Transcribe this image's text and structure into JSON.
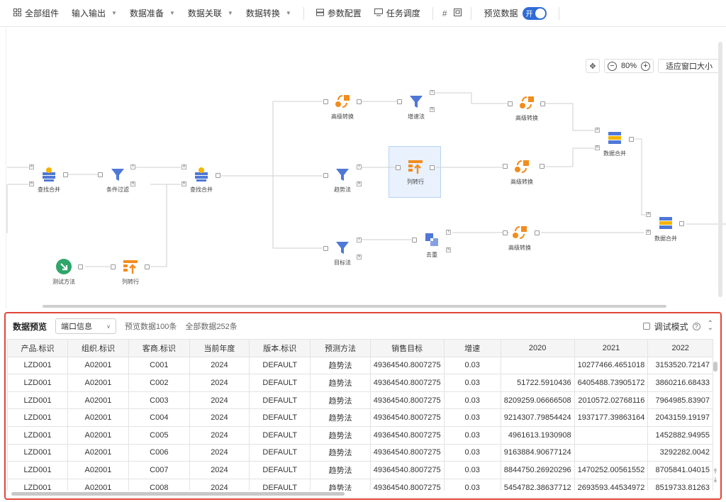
{
  "toolbar": {
    "all_components": "全部组件",
    "io": "输入输出",
    "data_prep": "数据准备",
    "data_join": "数据关联",
    "data_transform": "数据转换",
    "param_config": "参数配置",
    "task_schedule": "任务调度",
    "preview_data": "预览数据",
    "toggle_label": "开"
  },
  "zoom": {
    "percent": "80%",
    "fit": "适应窗口大小"
  },
  "nodes": {
    "lookup_merge_1": "查找合并",
    "cond_filter": "条件过滤",
    "lookup_merge_2": "查找合并",
    "test_method": "测试方法",
    "col_to_row_1": "列转行",
    "adv_transform_1": "高级转换",
    "growth_method": "增速法",
    "adv_transform_2": "高级转换",
    "data_merge_1": "数据合并",
    "trend_method": "趋势法",
    "col_to_row_2": "列转行",
    "adv_transform_3": "高级转换",
    "data_merge_2": "数据合并",
    "target_method": "目标法",
    "dedup": "去重",
    "adv_transform_4": "高级转换"
  },
  "preview": {
    "title": "数据预览",
    "select_value": "端口信息",
    "preview_count": "预览数据100条",
    "total_count": "全部数据252条",
    "debug_mode": "调试模式"
  },
  "table": {
    "headers": [
      "产品.标识",
      "组织.标识",
      "客商.标识",
      "当前年度",
      "版本.标识",
      "预测方法",
      "销售目标",
      "增速",
      "2020",
      "2021",
      "2022"
    ],
    "rows": [
      [
        "LZD001",
        "A02001",
        "C001",
        "2024",
        "DEFAULT",
        "趋势法",
        "49364540.8007275",
        "0.03",
        "",
        "10277466.4651018",
        "3153520.72147"
      ],
      [
        "LZD001",
        "A02001",
        "C002",
        "2024",
        "DEFAULT",
        "趋势法",
        "49364540.8007275",
        "0.03",
        "51722.5910436",
        "6405488.73905172",
        "3860216.68433"
      ],
      [
        "LZD001",
        "A02001",
        "C003",
        "2024",
        "DEFAULT",
        "趋势法",
        "49364540.8007275",
        "0.03",
        "8209259.06666508",
        "2010572.02768116",
        "7964985.83907"
      ],
      [
        "LZD001",
        "A02001",
        "C004",
        "2024",
        "DEFAULT",
        "趋势法",
        "49364540.8007275",
        "0.03",
        "9214307.79854424",
        "1937177.39863164",
        "2043159.19197"
      ],
      [
        "LZD001",
        "A02001",
        "C005",
        "2024",
        "DEFAULT",
        "趋势法",
        "49364540.8007275",
        "0.03",
        "4961613.1930908",
        "",
        "1452882.94955"
      ],
      [
        "LZD001",
        "A02001",
        "C006",
        "2024",
        "DEFAULT",
        "趋势法",
        "49364540.8007275",
        "0.03",
        "9163884.90677124",
        "",
        "3292282.0042"
      ],
      [
        "LZD001",
        "A02001",
        "C007",
        "2024",
        "DEFAULT",
        "趋势法",
        "49364540.8007275",
        "0.03",
        "8844750.26920296",
        "1470252.00561552",
        "8705841.04015"
      ],
      [
        "LZD001",
        "A02001",
        "C008",
        "2024",
        "DEFAULT",
        "趋势法",
        "49364540.8007275",
        "0.03",
        "5454782.38637712",
        "2693593.44534972",
        "8519733.81263"
      ]
    ]
  },
  "colors": {
    "accent": "#2f6bd6",
    "highlight_border": "#e0463a",
    "orange": "#f28c1e",
    "blue_funnel": "#4f78d6",
    "green": "#2fa56a"
  }
}
